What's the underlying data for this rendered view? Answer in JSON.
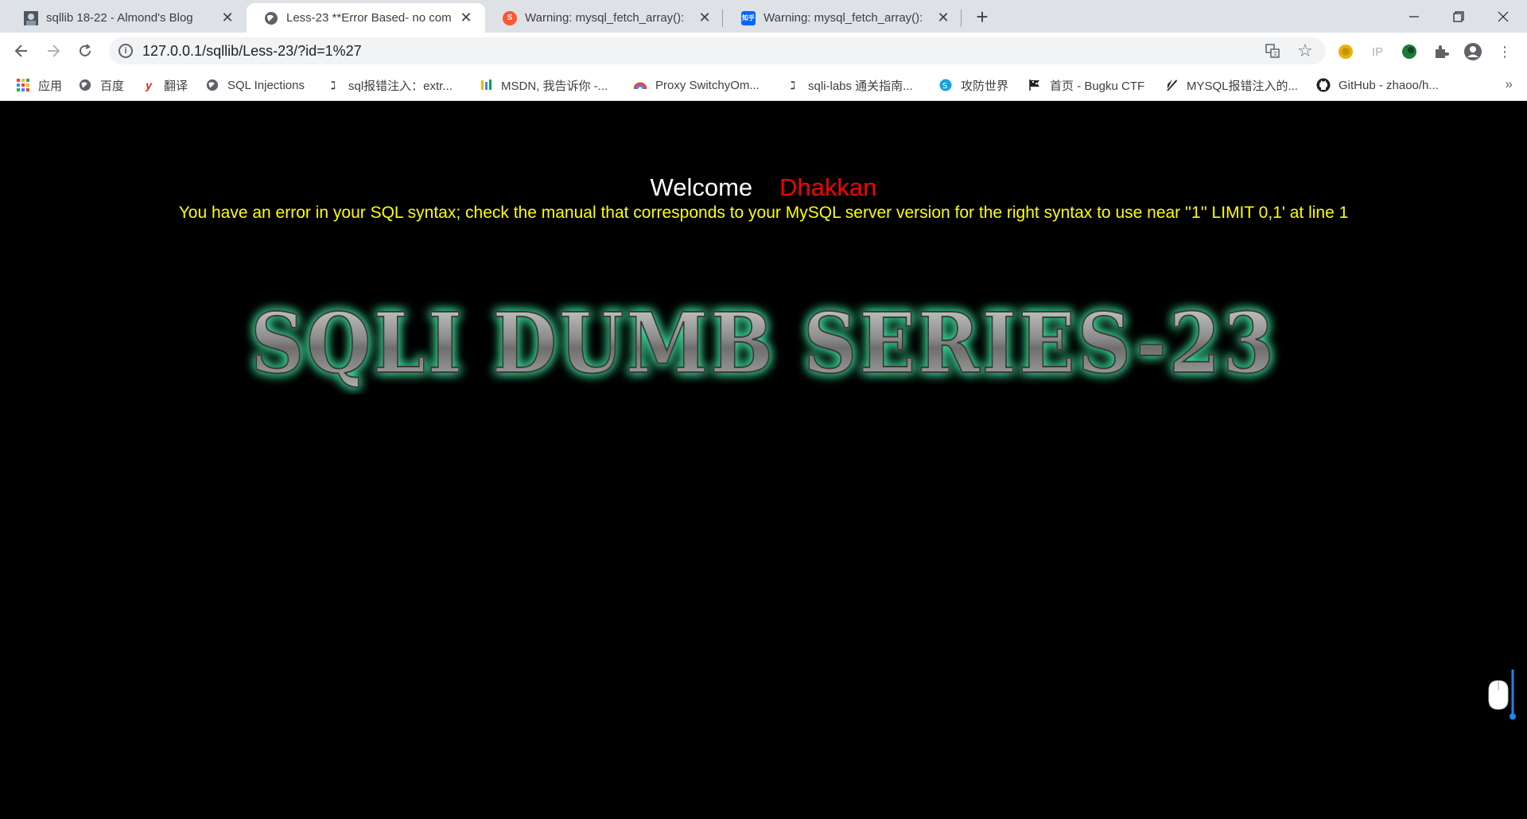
{
  "tabs": [
    {
      "title": "sqllib 18-22 - Almond's Blog",
      "favicon": "avatar-icon",
      "active": false
    },
    {
      "title": "Less-23 **Error Based- no com",
      "favicon": "globe-icon",
      "active": true
    },
    {
      "title": "Warning: mysql_fetch_array():",
      "favicon": "csdn-icon",
      "active": false
    },
    {
      "title": "Warning: mysql_fetch_array():",
      "favicon": "zhihu-icon",
      "active": false
    }
  ],
  "toolbar": {
    "url": "127.0.0.1/sqllib/Less-23/?id=1%27",
    "ip_ext_label": "IP"
  },
  "bookmarks": [
    {
      "label": "应用",
      "icon": "apps-grid-icon"
    },
    {
      "label": "百度",
      "icon": "globe-icon"
    },
    {
      "label": "翻译",
      "icon": "youdao-icon"
    },
    {
      "label": "SQL Injections",
      "icon": "globe-icon"
    },
    {
      "label": "sql报错注入：extr...",
      "icon": "blog-icon"
    },
    {
      "label": "MSDN, 我告诉你 -...",
      "icon": "msdn-icon"
    },
    {
      "label": "Proxy SwitchyOm...",
      "icon": "switchyomega-icon"
    },
    {
      "label": "sqli-labs 通关指南...",
      "icon": "blog-icon"
    },
    {
      "label": "攻防世界",
      "icon": "adworld-icon"
    },
    {
      "label": "首页 - Bugku CTF",
      "icon": "flag-icon"
    },
    {
      "label": "MYSQL报错注入的...",
      "icon": "feather-icon"
    },
    {
      "label": "GitHub - zhaoo/h...",
      "icon": "github-icon"
    }
  ],
  "page": {
    "welcome_word": "Welcome",
    "welcome_name": "Dhakkan",
    "error_message": "You have an error in your SQL syntax; check the manual that corresponds to your MySQL server version for the right syntax to use near ''1'' LIMIT 0,1' at line 1",
    "banner_text": "SQLI DUMB SERIES-23"
  },
  "colors": {
    "page_bg": "#000000",
    "welcome": "#ffffff",
    "name": "#ff0000",
    "error": "#ffff00",
    "banner_glow": "#3ddc9a"
  }
}
